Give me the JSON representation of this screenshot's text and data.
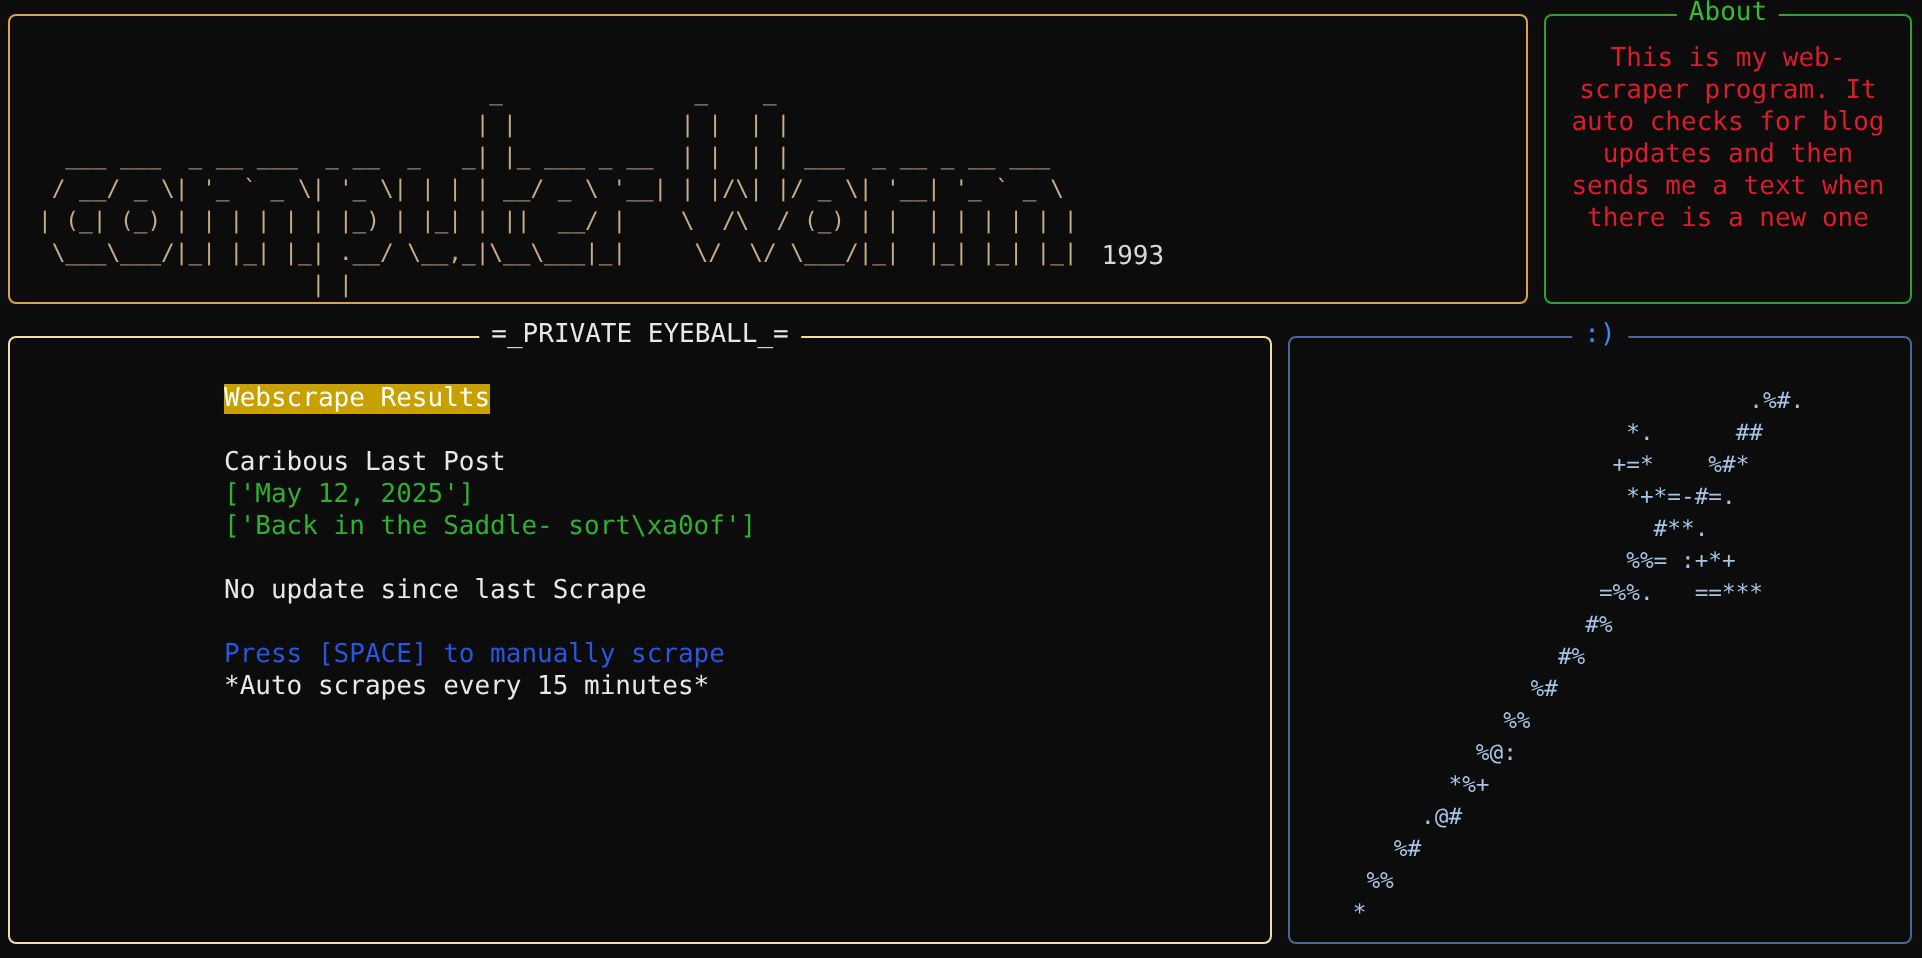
{
  "banner": {
    "art_lines": [
      "                                 _              _    _",
      "                                | |            | |  | |",
      "  ___ ___  _ __ ___  _ __  _   _| |_ ___ _ __  | |  | | ___  _ __ _ __ ___",
      " / __/ _ \\| '_ ` _ \\| '_ \\| | | | __/ _ \\ '__| | |/\\| |/ _ \\| '__| '_ ` _ \\",
      "| (_| (_) | | | | | | |_) | |_| | ||  __/ |    \\  /\\  / (_) | |  | | | | | |",
      " \\___\\___/|_| |_| |_| .__/ \\__,_|\\__\\___|_|     \\/  \\/ \\___/|_|  |_| |_| |_|",
      "                    | |"
    ],
    "year": "1993"
  },
  "about": {
    "title": "About",
    "text": "This is my web-scraper program. It auto checks for blog updates and then sends me a text when there is a new one"
  },
  "main": {
    "title": "=_PRIVATE EYEBALL_=",
    "lines": [
      {
        "kind": "heading",
        "text": "Webscrape Results"
      },
      {
        "kind": "blank"
      },
      {
        "kind": "plain",
        "text": "Caribous Last Post"
      },
      {
        "kind": "result",
        "text": "['May 12, 2025']"
      },
      {
        "kind": "result",
        "text": "['Back in the Saddle- sort\\xa0of']"
      },
      {
        "kind": "blank"
      },
      {
        "kind": "plain",
        "text": "No update since last Scrape"
      },
      {
        "kind": "blank"
      },
      {
        "kind": "hint",
        "text": "Press [SPACE] to manually scrape"
      },
      {
        "kind": "plain",
        "text": "*Auto scrapes every 15 minutes*"
      }
    ]
  },
  "art_panel": {
    "title": ":)",
    "lines": [
      "                                 .%#.",
      "                        *.      ##",
      "                       +=*    %#*",
      "                        *+*=-#=.",
      "                          #**.",
      "                        %%= :+*+",
      "                      =%%.   ==***",
      "                     #%",
      "                   #%",
      "                 %#",
      "               %%",
      "             %@:",
      "           *%+",
      "         .@#",
      "       %#",
      "     %%",
      "    *"
    ]
  }
}
